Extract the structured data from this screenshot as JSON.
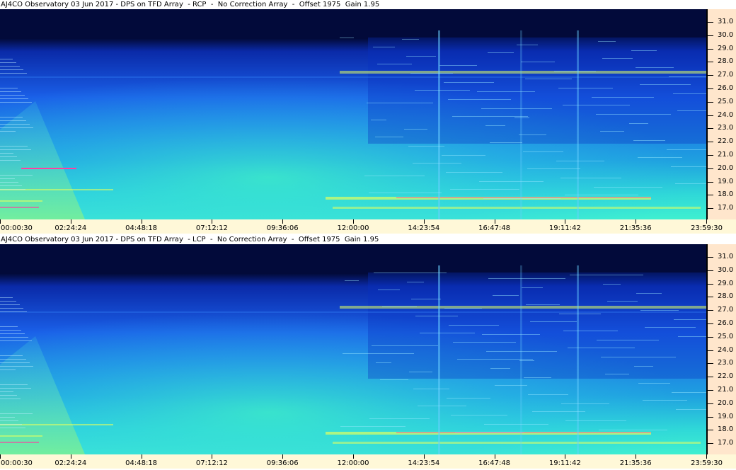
{
  "panels": [
    {
      "title": "AJ4CO Observatory 03 Jun 2017 - DPS on TFD Array  - RCP  -  No Correction Array  -  Offset 1975  Gain 1.95",
      "polarization": "RCP"
    },
    {
      "title": "AJ4CO Observatory 03 Jun 2017 - DPS on TFD Array  - LCP  -  No Correction Array  -  Offset 1975  Gain 1.95",
      "polarization": "LCP"
    }
  ],
  "freq_axis": {
    "unit_hint": "MHz",
    "ticks": [
      "31.0",
      "30.0",
      "29.0",
      "28.0",
      "27.0",
      "26.0",
      "25.0",
      "24.0",
      "23.0",
      "22.0",
      "21.0",
      "20.0",
      "19.0",
      "18.0",
      "17.0"
    ]
  },
  "time_axis": {
    "ticks": [
      "00:00:30",
      "02:24:24",
      "04:48:18",
      "07:12:12",
      "09:36:06",
      "12:00:00",
      "14:23:54",
      "16:47:48",
      "19:11:42",
      "21:35:36",
      "23:59:30"
    ]
  },
  "colors": {
    "axis_bg": "#ffe6cc",
    "time_axis_bg": "#fff8d8",
    "spectro_top": "#020a3a",
    "spectro_mid": "#1a5fe8",
    "spectro_low": "#2fd8d8",
    "spectro_bottom": "#3ff0d0",
    "hot_line": "#e0ff60",
    "rfi_line": "#ff40a0"
  }
}
